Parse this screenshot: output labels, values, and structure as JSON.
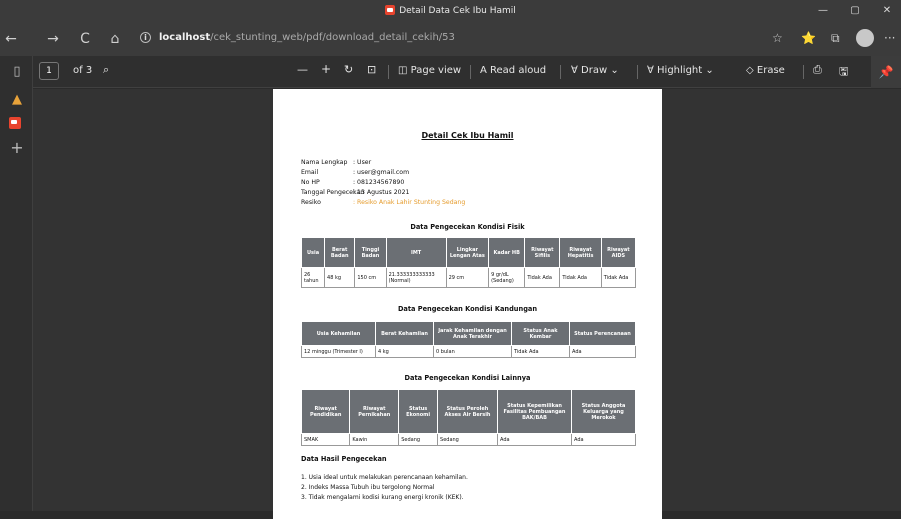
{
  "window": {
    "title": "Detail Data Cek Ibu Hamil",
    "min": "—",
    "max": "▢",
    "close": "✕"
  },
  "address": {
    "host": "localhost",
    "path": "/cek_stunting_web/pdf/download_detail_cekih/53",
    "info": "i"
  },
  "browser_icons": {
    "back": "←",
    "forward": "→",
    "refresh": "C",
    "home": "⌂",
    "fav": "☆",
    "favlist": "⭐",
    "collections": "⧉",
    "more": "···"
  },
  "pdfbar": {
    "page_num": "1",
    "page_total": "of 3",
    "search": "⌕",
    "zoom_out": "—",
    "zoom_in": "+",
    "rotate": "↻",
    "fit": "⊡",
    "page_view": "Page view",
    "read_aloud": "Read aloud",
    "draw": "Draw",
    "highlight": "Highlight",
    "erase": "Erase",
    "print": "⎙",
    "save": "🖫",
    "pin": "📌",
    "readaloud_icon": "A",
    "draw_icon": "∀",
    "highlight_icon": "∀",
    "erase_icon": "◇",
    "pageview_icon": "◫",
    "chev": "⌄"
  },
  "sidebar": {
    "plus": "+"
  },
  "doc": {
    "title": "Detail Cek Ibu Hamil",
    "info": [
      {
        "label": "Nama Lengkap",
        "value": ": User"
      },
      {
        "label": "Email",
        "value": ": user@gmail.com"
      },
      {
        "label": "No HP",
        "value": ": 081234567890"
      },
      {
        "label": "Tanggal Pengecekan",
        "value": ": 13 Agustus 2021"
      },
      {
        "label": "Resiko",
        "value": ": Resiko Anak Lahir Stunting Sedang"
      }
    ],
    "fisik": {
      "title": "Data Pengecekan Kondisi Fisik",
      "headers": [
        "Usia",
        "Berat Badan",
        "Tinggi Badan",
        "IMT",
        "Lingkar Lengan Atas",
        "Kadar HB",
        "Riwayat Sifilis",
        "Riwayat Hepatitis",
        "Riwayat AIDS"
      ],
      "row": [
        "26 tahun",
        "48 kg",
        "150 cm",
        "21.333333333333 (Normal)",
        "29 cm",
        "9 gr/dL (Sedang)",
        "Tidak Ada",
        "Tidak Ada",
        "Tidak Ada"
      ]
    },
    "kandungan": {
      "title": "Data Pengecekan Kondisi Kandungan",
      "headers": [
        "Usia Kehamilan",
        "Berat Kehamilan",
        "Jarak Kehamilan dengan Anak Terakhir",
        "Status Anak Kembar",
        "Status Perencanaan"
      ],
      "row": [
        "12 minggu (Trimester I)",
        "4 kg",
        "0 bulan",
        "Tidak Ada",
        "Ada"
      ]
    },
    "lainnya": {
      "title": "Data Pengecekan Kondisi Lainnya",
      "headers": [
        "Riwayat Pendidikan",
        "Riwayat Pernikahan",
        "Status Ekonomi",
        "Status Peroleh Akses Air Bersih",
        "Status Kepemilikan Fasilitas Pembuangan BAK/BAB",
        "Status Anggota Keluarga yang Merokok"
      ],
      "row": [
        "SMAK",
        "Kawin",
        "Sedang",
        "Sedang",
        "Ada",
        "Ada"
      ]
    },
    "hasil": {
      "title": "Data Hasil Pengecekan",
      "items": [
        "1.   Usia ideal untuk melakukan perencanaan kehamilan.",
        "2.   Indeks Massa Tubuh ibu tergolong Normal",
        "3.   Tidak mengalami kodisi kurang energi kronik (KEK)."
      ]
    }
  }
}
